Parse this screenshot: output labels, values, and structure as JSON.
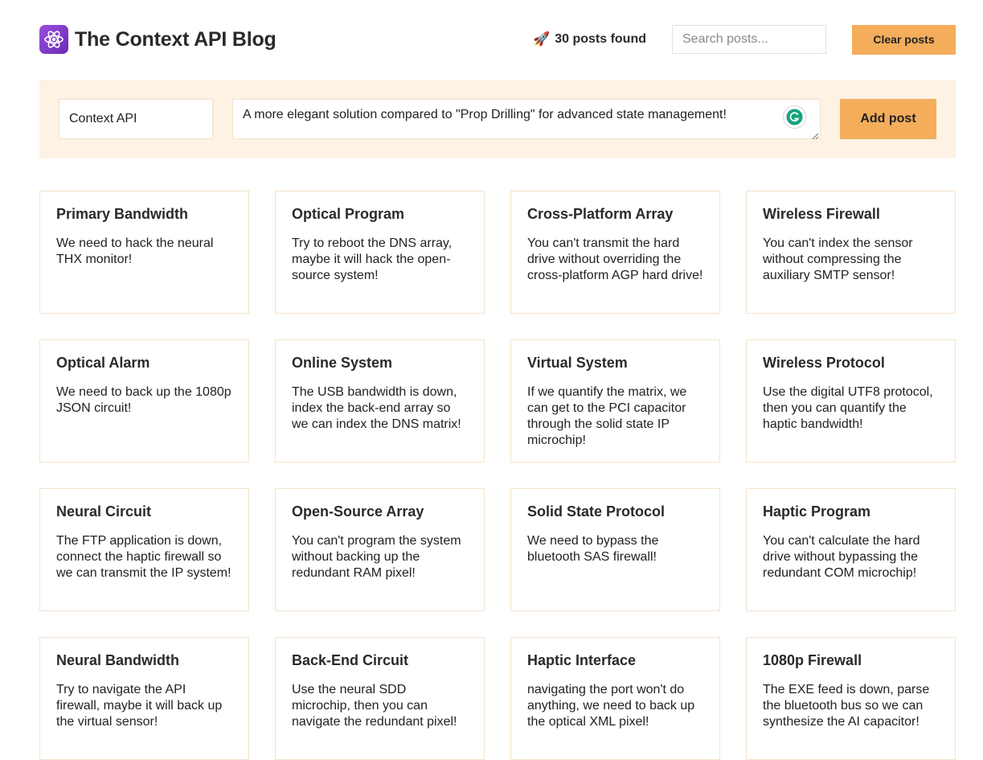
{
  "header": {
    "logo_icon": "atom-icon",
    "title": "The Context API Blog",
    "count_icon": "rocket-icon",
    "count_text": "30 posts found",
    "search_placeholder": "Search posts...",
    "clear_label": "Clear posts"
  },
  "form": {
    "title_value": "Context API",
    "body_value": "A more elegant solution compared to \"Prop Drilling\" for advanced state management!",
    "add_label": "Add post"
  },
  "colors": {
    "accent": "#f3ad5b",
    "panel_bg": "#fdf2e4",
    "logo": "#8a3fd1"
  },
  "posts": [
    {
      "title": "Primary Bandwidth",
      "body": "We need to hack the neural THX monitor!"
    },
    {
      "title": "Optical Program",
      "body": "Try to reboot the DNS array, maybe it will hack the open-source system!"
    },
    {
      "title": "Cross-Platform Array",
      "body": "You can't transmit the hard drive without overriding the cross-platform AGP hard drive!"
    },
    {
      "title": "Wireless Firewall",
      "body": "You can't index the sensor without compressing the auxiliary SMTP sensor!"
    },
    {
      "title": "Optical Alarm",
      "body": "We need to back up the 1080p JSON circuit!"
    },
    {
      "title": "Online System",
      "body": "The USB bandwidth is down, index the back-end array so we can index the DNS matrix!"
    },
    {
      "title": "Virtual System",
      "body": "If we quantify the matrix, we can get to the PCI capacitor through the solid state IP microchip!"
    },
    {
      "title": "Wireless Protocol",
      "body": "Use the digital UTF8 protocol, then you can quantify the haptic bandwidth!"
    },
    {
      "title": "Neural Circuit",
      "body": "The FTP application is down, connect the haptic firewall so we can transmit the IP system!"
    },
    {
      "title": "Open-Source Array",
      "body": "You can't program the system without backing up the redundant RAM pixel!"
    },
    {
      "title": "Solid State Protocol",
      "body": "We need to bypass the bluetooth SAS firewall!"
    },
    {
      "title": "Haptic Program",
      "body": "You can't calculate the hard drive without bypassing the redundant COM microchip!"
    },
    {
      "title": "Neural Bandwidth",
      "body": "Try to navigate the API firewall, maybe it will back up the virtual sensor!"
    },
    {
      "title": "Back-End Circuit",
      "body": "Use the neural SDD microchip, then you can navigate the redundant pixel!"
    },
    {
      "title": "Haptic Interface",
      "body": "navigating the port won't do anything, we need to back up the optical XML pixel!"
    },
    {
      "title": "1080p Firewall",
      "body": "The EXE feed is down, parse the bluetooth bus so we can synthesize the AI capacitor!"
    }
  ]
}
